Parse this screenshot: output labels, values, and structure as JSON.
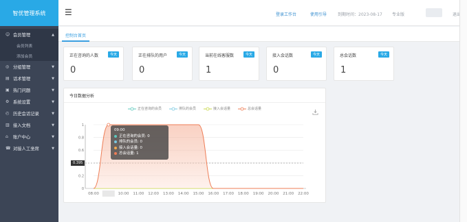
{
  "app": {
    "title": "智优管理系统"
  },
  "sidebar": {
    "items": [
      {
        "label": "会员管理",
        "icon": "user-icon",
        "expanded": true
      },
      {
        "label": "分组管理",
        "icon": "group-icon"
      },
      {
        "label": "话术管理",
        "icon": "doc-icon"
      },
      {
        "label": "热门问题",
        "icon": "hot-icon"
      },
      {
        "label": "系统设置",
        "icon": "gear-icon"
      },
      {
        "label": "历史会话记录",
        "icon": "history-icon"
      },
      {
        "label": "接入文档",
        "icon": "file-icon"
      },
      {
        "label": "账户中心",
        "icon": "account-icon"
      },
      {
        "label": "对接人工坐席",
        "icon": "agent-icon"
      }
    ],
    "submenu": [
      "会员列表",
      "添加会员"
    ]
  },
  "header": {
    "links": [
      "登录工作台",
      "使用引导"
    ],
    "expiry": "到期时间：2023-08-17",
    "edition": "专业版",
    "logout": "退出"
  },
  "tabs": [
    "控制台首页"
  ],
  "cards": [
    {
      "title": "正在咨询的人数",
      "badge": "今天",
      "value": "0"
    },
    {
      "title": "正在排队的用户",
      "badge": "今天",
      "value": "0"
    },
    {
      "title": "当前在线客服数",
      "badge": "今天",
      "value": "1"
    },
    {
      "title": "接入会话数",
      "badge": "今天",
      "value": "0"
    },
    {
      "title": "总会话数",
      "badge": "今天",
      "value": "1"
    }
  ],
  "panel": {
    "title": "今日数据分析"
  },
  "tooltip": {
    "time": "09:00",
    "rows": [
      {
        "label": "正在咨询的会员: 0",
        "color": "#5ec8bd"
      },
      {
        "label": "排队的会员: 0",
        "color": "#7ac8e0"
      },
      {
        "label": "接入会话量: 0",
        "color": "#f1a94e"
      },
      {
        "label": "总会话量: 1",
        "color": "#ee7d56"
      }
    ]
  },
  "y_pointer_label": "0.395",
  "chart_data": {
    "type": "line",
    "x": [
      "08:00",
      "09:00",
      "10:00",
      "11:00",
      "12:00",
      "13:00",
      "14:00",
      "15:00",
      "16:00",
      "17:00",
      "18:00",
      "19:00",
      "20:00",
      "21:00",
      "22:00"
    ],
    "series": [
      {
        "name": "正在咨询的会员",
        "color": "#5ec8bd",
        "values": [
          0,
          0,
          0,
          0,
          0,
          0,
          0,
          0,
          0,
          0,
          0,
          0,
          0,
          0,
          0
        ]
      },
      {
        "name": "排队的会员",
        "color": "#7ac8e0",
        "values": [
          0,
          0,
          0,
          0,
          0,
          0,
          0,
          0,
          0,
          0,
          0,
          0,
          0,
          0,
          0
        ]
      },
      {
        "name": "接入会话量",
        "color": "#c8d84a",
        "values": [
          0,
          0,
          0,
          0,
          0,
          0,
          0,
          0,
          0,
          0,
          0,
          0,
          0,
          0,
          0
        ]
      },
      {
        "name": "总会话量",
        "color": "#ee7d56",
        "values": [
          0,
          1,
          1,
          1,
          1,
          1,
          1,
          1,
          0,
          0,
          0,
          0,
          0,
          0,
          0
        ]
      }
    ],
    "yticks": [
      0,
      0.2,
      0.4,
      0.6,
      0.8,
      1
    ],
    "ylim": [
      0,
      1
    ],
    "grid": true,
    "legend": "top-center",
    "title": ""
  }
}
